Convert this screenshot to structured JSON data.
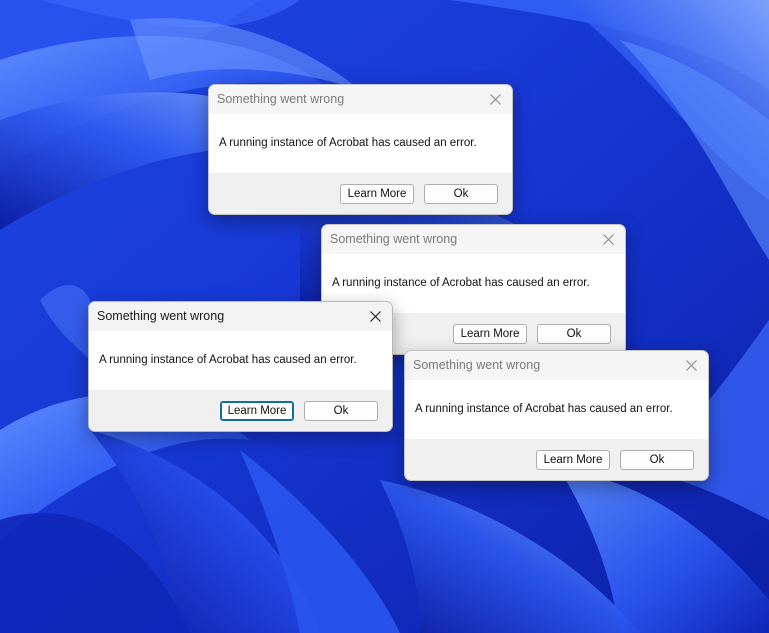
{
  "desktop": {
    "wallpaper": "windows-11-bloom",
    "colors": {
      "deep": "#0a1a9e",
      "mid": "#1f46e6",
      "light": "#5c8dff"
    }
  },
  "dialogs": [
    {
      "title": "Something went wrong",
      "message": "A running instance of Acrobat has caused an error.",
      "learn_more_label": "Learn More",
      "ok_label": "Ok",
      "active": false
    },
    {
      "title": "Something went wrong",
      "message": "A running instance of Acrobat has caused an error.",
      "learn_more_label": "Learn More",
      "ok_label": "Ok",
      "active": false
    },
    {
      "title": "Something went wrong",
      "message": "A running instance of Acrobat has caused an error.",
      "learn_more_label": "Learn More",
      "ok_label": "Ok",
      "active": true
    },
    {
      "title": "Something went wrong",
      "message": "A running instance of Acrobat has caused an error.",
      "learn_more_label": "Learn More",
      "ok_label": "Ok",
      "active": false
    }
  ],
  "icons": {
    "close": "close-icon"
  }
}
